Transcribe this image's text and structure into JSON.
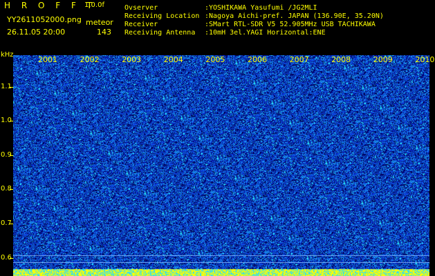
{
  "header": {
    "app_title": "H R O F F T",
    "app_version": "1.0.0f",
    "file_name": "YY2611052000.png",
    "mode_label": "meteor",
    "datetime": "26.11.05 20:00",
    "count": "143"
  },
  "station": {
    "observer_label": "Ovserver",
    "observer_value": ":YOSHIKAWA Yasufumi /JG2MLI",
    "location_label": "Receiving Location",
    "location_value": ":Nagoya Aichi-pref. JAPAN (136.90E, 35.20N)",
    "receiver_label": "Receiver",
    "receiver_value": ":SMart RTL-SDR V5 52.905MHz USB TACHIKAWA",
    "antenna_label": "Receiving Antenna",
    "antenna_value": ":10mH 3el.YAGI Horizontal:ENE"
  },
  "axis": {
    "unit_label": "kHz",
    "y_ticks": [
      "1.1",
      "1.0",
      "0.9",
      "0.8",
      "0.7",
      "0.6"
    ],
    "time_labels": [
      "2001",
      "2002",
      "2003",
      "2004",
      "2005",
      "2006",
      "2007",
      "2008",
      "2009",
      "2010"
    ]
  },
  "colors": {
    "text": "#ffff00",
    "noise_dark": "#000050",
    "noise_mid": "#0a2cc8",
    "noise_bright": "#2ad6ff",
    "peak": "#ffff00"
  }
}
